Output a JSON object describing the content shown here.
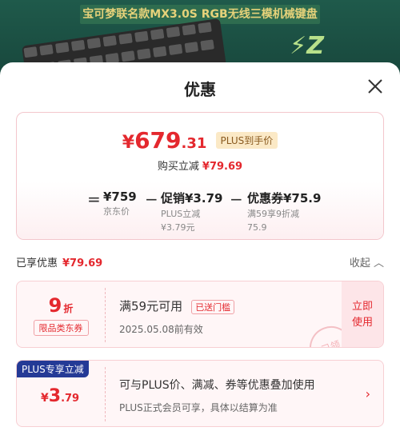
{
  "banner": {
    "title": "宝可梦联名款MX3.0S RGB无线三模机械键盘"
  },
  "sheet": {
    "title": "优惠",
    "close_icon": "close-icon"
  },
  "summary": {
    "price_currency": "¥",
    "price_int": "679",
    "price_dec": ".31",
    "plus_tag": "PLUS到手价",
    "save_label": "购买立减",
    "save_amount": "¥79.69",
    "formula": {
      "eq": "=",
      "minus": "−",
      "jd_price": "¥759",
      "jd_label": "京东价",
      "promo_price": "促销¥3.79",
      "promo_sub1": "PLUS立减",
      "promo_sub2": "¥3.79元",
      "coupon_price": "优惠券¥75.9",
      "coupon_sub1_a": "满59享9折减",
      "coupon_sub2": "75.9"
    }
  },
  "enjoyed": {
    "label": "已享优惠",
    "amount": "¥79.69",
    "collapse": "收起"
  },
  "coupon": {
    "discount_num": "9",
    "discount_unit": "折",
    "scope": "限品类东券",
    "condition": "满59元可用",
    "got_tag": "已送门槛",
    "expiry": "2025.05.08前有效",
    "action_line1": "立即",
    "action_line2": "使用",
    "stamp": "已领"
  },
  "plus_card": {
    "badge": "PLUS专享立减",
    "currency": "¥",
    "value_int": "3",
    "value_dec": ".79",
    "desc1": "可与PLUS价、满减、券等优惠叠加使用",
    "desc2": "PLUS正式会员可享，具体以结算为准",
    "chevron": "›"
  },
  "colors": {
    "accent": "#e4282e",
    "plus_blue": "#243a96"
  }
}
